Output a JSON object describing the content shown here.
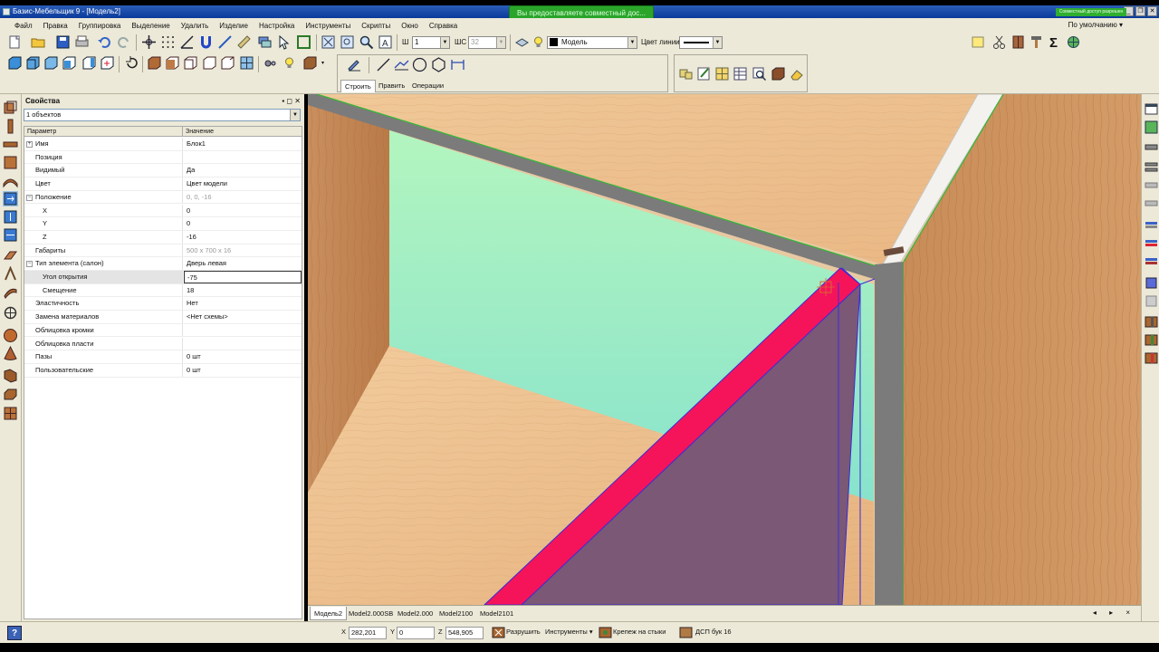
{
  "window": {
    "title": "Базис-Мебельщик 9 - [Модель2]",
    "share_badge": "Совместный доступ разрешен",
    "notification": "Вы предоставляете совместный дос..."
  },
  "menu": {
    "items": [
      "Файл",
      "Правка",
      "Группировка",
      "Выделение",
      "Удалить",
      "Изделие",
      "Настройка",
      "Инструменты",
      "Скрипты",
      "Окно",
      "Справка"
    ],
    "right": "По умолчанию ▾"
  },
  "toolbar": {
    "line_width_label": "Ш",
    "line_width_value": "1",
    "line_style_label": "ШС",
    "line_style_value": "32",
    "layer_value": "Модель",
    "line_color_label": "Цвет линии"
  },
  "draw_panel": {
    "tabs": [
      "Строить",
      "Править",
      "Операции"
    ]
  },
  "properties": {
    "title": "Свойства",
    "header_buttons": "▪ ◻ ✕",
    "object_select": "1 объектов",
    "col_param": "Параметр",
    "col_value": "Значение",
    "rows": [
      {
        "param": "Имя",
        "value": "Блок1"
      },
      {
        "param": "Позиция",
        "value": ""
      },
      {
        "param": "Видимый",
        "value": "Да"
      },
      {
        "param": "Цвет",
        "value": "Цвет модели"
      },
      {
        "param": "Положение",
        "value": "0, 0, -16"
      },
      {
        "param": "X",
        "value": "0"
      },
      {
        "param": "Y",
        "value": "0"
      },
      {
        "param": "Z",
        "value": "-16"
      },
      {
        "param": "Габариты",
        "value": "500 x 700 x 16"
      },
      {
        "param": "Тип элемента (салон)",
        "value": "Дверь левая"
      },
      {
        "param": "Угол открытия",
        "value": "-75"
      },
      {
        "param": "Смещение",
        "value": "18"
      },
      {
        "param": "Эластичность",
        "value": "Нет"
      },
      {
        "param": "Замена материалов",
        "value": "<Нет схемы>"
      },
      {
        "param": "Облицовка кромки",
        "value": ""
      },
      {
        "param": "Облицовка пласти",
        "value": ""
      },
      {
        "param": "Пазы",
        "value": "0 шт"
      },
      {
        "param": "Пользовательские",
        "value": "0 шт"
      }
    ]
  },
  "model_tabs": [
    "Модель2",
    "Model2.000SB",
    "Model2.000",
    "Model2100",
    "Model2101"
  ],
  "tab_nav": "◂ ▸ ×",
  "status": {
    "x_label": "X",
    "x_value": "282,201",
    "y_label": "Y",
    "y_value": "0",
    "z_label": "Z",
    "z_value": "548,905",
    "destroy": "Разрушить",
    "tools": "Инструменты ▾",
    "joints": "Крепеж на стыки",
    "material": "ДСП бук 16"
  },
  "colors": {
    "wood": "#e8c29a",
    "side_wood": "#c48a5a",
    "back_panel": "#9eeebd",
    "edge_grey": "#7b7b7b",
    "door": "#7a5876",
    "door_edge": "#f5145a",
    "selection_blue": "#3a2bd8",
    "green_outline": "#3bb53b"
  }
}
